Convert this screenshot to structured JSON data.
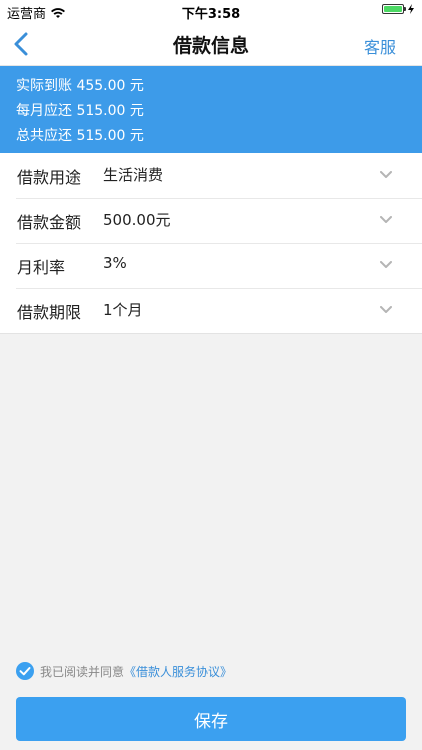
{
  "status_bar": {
    "carrier": "运营商",
    "time": "下午3:58"
  },
  "nav": {
    "title": "借款信息",
    "right_label": "客服"
  },
  "summary": {
    "lines": [
      "实际到账 455.00 元",
      "每月应还 515.00 元",
      "总共应还 515.00 元"
    ]
  },
  "form": {
    "rows": [
      {
        "label": "借款用途",
        "value": "生活消费"
      },
      {
        "label": "借款金额",
        "value": "500.00元"
      },
      {
        "label": "月利率",
        "value": "3%"
      },
      {
        "label": "借款期限",
        "value": "1个月"
      }
    ]
  },
  "agreement": {
    "checked": true,
    "text": "我已阅读并同意",
    "link": "《借款人服务协议》"
  },
  "save_label": "保存",
  "colors": {
    "accent": "#3d9be9",
    "link": "#3a8fd9",
    "button": "#3ba0f0"
  }
}
